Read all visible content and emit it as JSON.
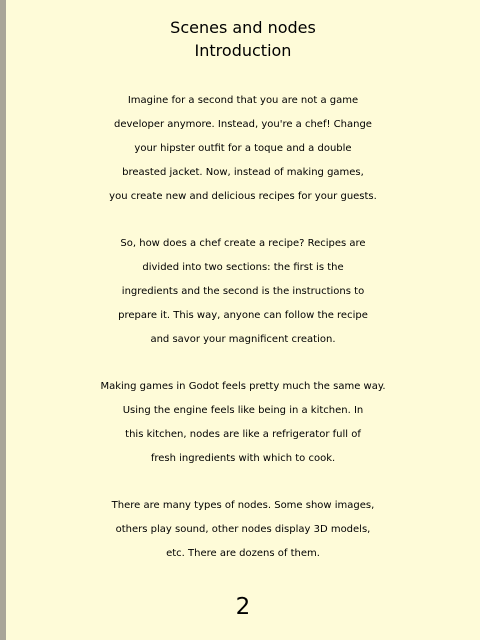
{
  "header": {
    "line1": "Scenes and nodes",
    "line2": "Introduction"
  },
  "paragraphs": [
    {
      "lines": [
        "Imagine for a second that you are not a game",
        "developer anymore. Instead, you're a chef! Change",
        "your hipster outfit for a toque and a double",
        "breasted jacket. Now, instead of making games,",
        "you create new and delicious recipes for your guests."
      ]
    },
    {
      "lines": [
        "So, how does a chef create a recipe? Recipes are",
        "divided into two sections: the first is the",
        "ingredients and the second is the instructions to",
        "prepare it. This way, anyone can follow the recipe",
        "and savor your magnificent creation."
      ]
    },
    {
      "lines": [
        "Making games in Godot feels pretty much the same way.",
        "Using the engine feels like being in a kitchen. In",
        "this kitchen, nodes are like a refrigerator full of",
        "fresh ingredients with which to cook."
      ]
    },
    {
      "lines": [
        "There are many types of nodes. Some show images,",
        "others play sound, other nodes display 3D models,",
        "etc. There are dozens of them."
      ]
    }
  ],
  "page_number": "2"
}
